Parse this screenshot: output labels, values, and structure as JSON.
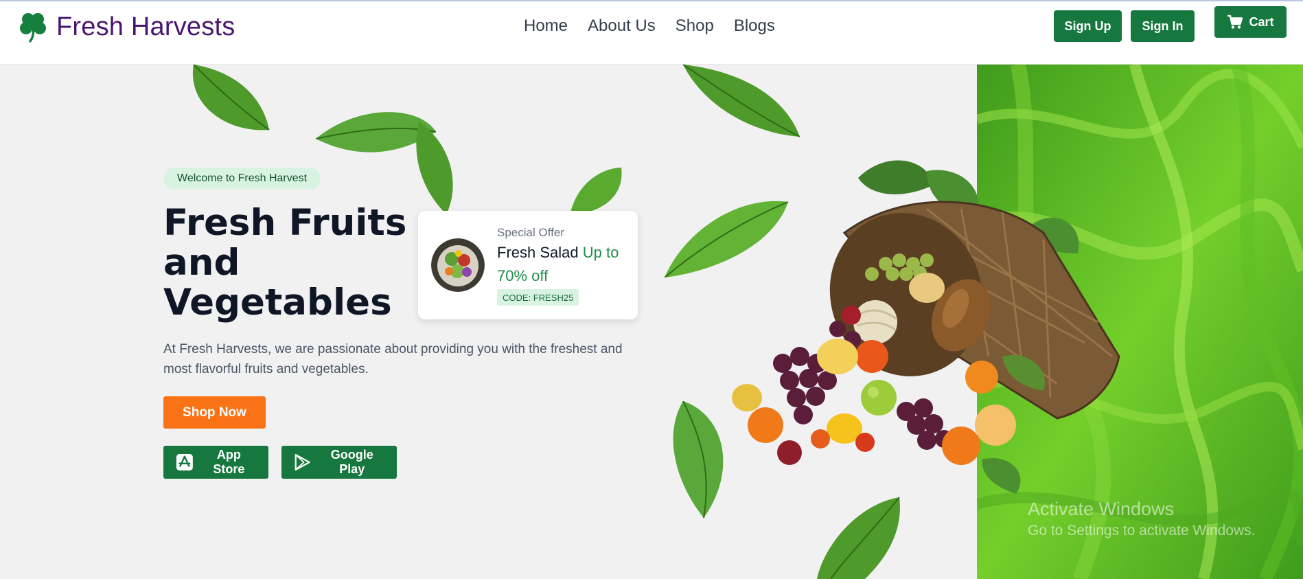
{
  "brand": {
    "name": "Fresh Harvests",
    "icon": "clover-icon",
    "color": "#4a1570"
  },
  "nav": {
    "links": [
      "Home",
      "About Us",
      "Shop",
      "Blogs"
    ],
    "signup_label": "Sign Up",
    "signin_label": "Sign In",
    "cart_label": "Cart"
  },
  "hero": {
    "welcome": "Welcome to Fresh Harvest",
    "title_line1": "Fresh Fruits",
    "title_line2": "and",
    "title_line3": "Vegetables",
    "description": "At Fresh Harvests, we are passionate about providing you with the freshest and most flavorful fruits and vegetables.",
    "shop_button": "Shop Now",
    "app_store": "App Store",
    "google_play": "Google Play"
  },
  "offer": {
    "label": "Special Offer",
    "title": "Fresh Salad",
    "highlight": "Up to 70% off",
    "code": "CODE: FRESH25"
  },
  "watermark": {
    "title": "Activate Windows",
    "subtitle": "Go to Settings to activate Windows."
  },
  "colors": {
    "primary_green": "#16783e",
    "accent_orange": "#f97316",
    "panel_green": "#6fcf2a",
    "hero_bg": "#f1f1f2"
  }
}
